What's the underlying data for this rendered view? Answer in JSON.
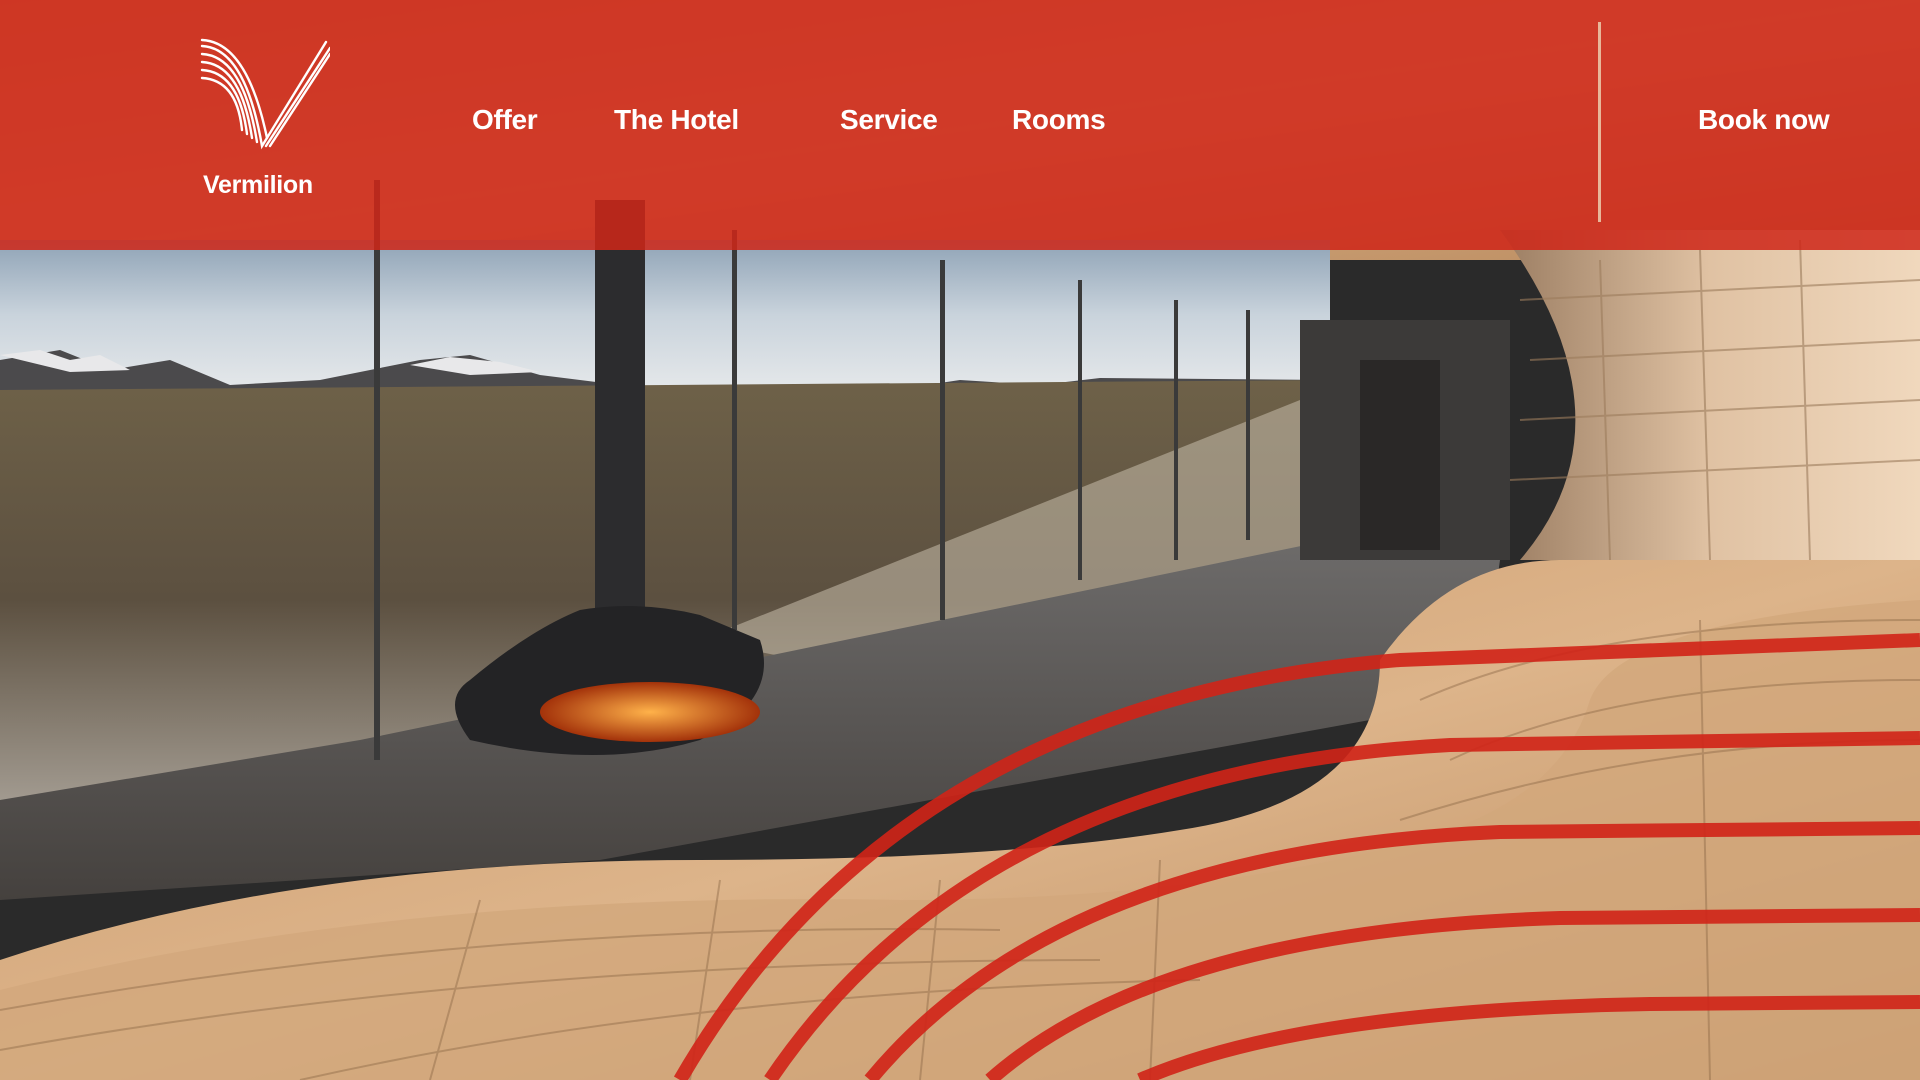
{
  "brand": {
    "name": "Vermilion",
    "logo_icon": "vermilion-v-logo",
    "accent_color": "#ce2618"
  },
  "nav": {
    "items": [
      {
        "label": "Offer"
      },
      {
        "label": "The Hotel"
      },
      {
        "label": "Service"
      },
      {
        "label": "Rooms"
      }
    ],
    "cta_label": "Book now"
  },
  "hero": {
    "image": "hotel-lounge-with-hanging-fireplace-and-mountain-view",
    "decoration": "red-wave-lines"
  }
}
